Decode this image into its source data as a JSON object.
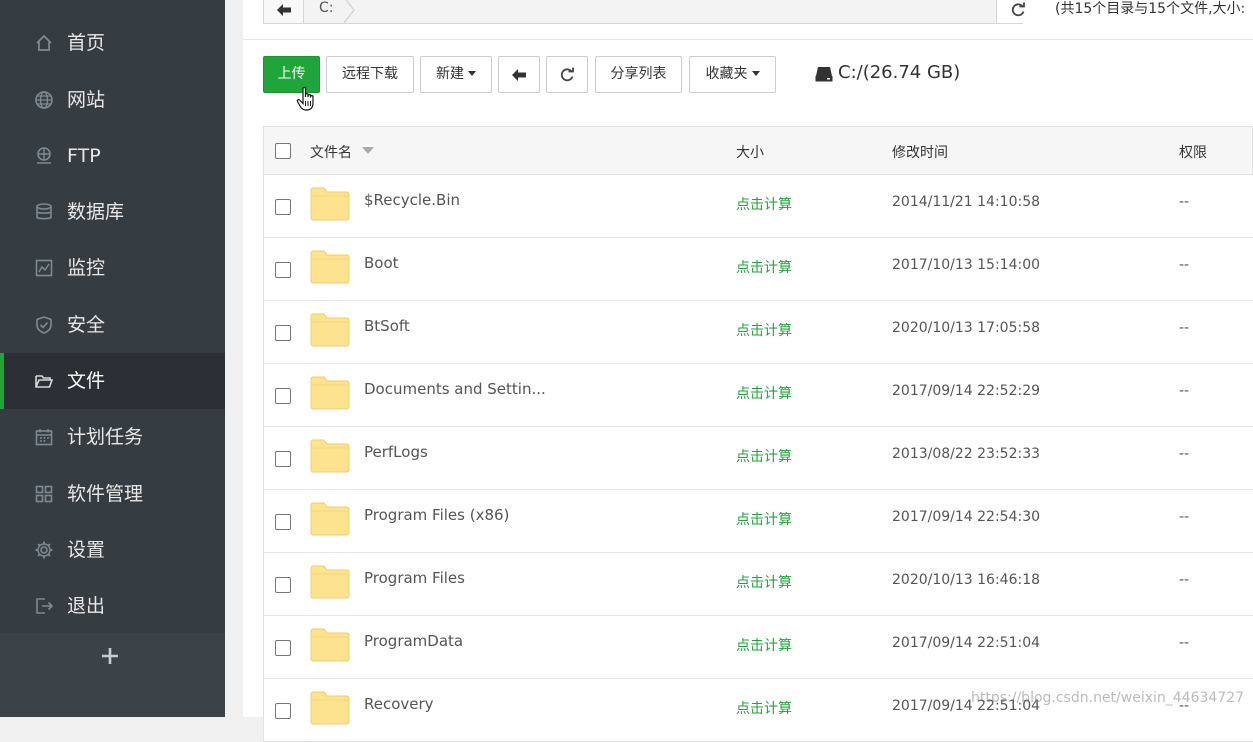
{
  "sidebar": {
    "items": [
      {
        "label": "首页",
        "icon": "home-icon"
      },
      {
        "label": "网站",
        "icon": "globe-icon"
      },
      {
        "label": "FTP",
        "icon": "ftp-icon"
      },
      {
        "label": "数据库",
        "icon": "database-icon"
      },
      {
        "label": "监控",
        "icon": "monitor-icon"
      },
      {
        "label": "安全",
        "icon": "shield-icon"
      },
      {
        "label": "文件",
        "icon": "folder-icon",
        "active": true
      },
      {
        "label": "计划任务",
        "icon": "calendar-icon"
      },
      {
        "label": "软件管理",
        "icon": "apps-icon"
      },
      {
        "label": "设置",
        "icon": "gear-icon"
      },
      {
        "label": "退出",
        "icon": "logout-icon"
      }
    ],
    "add_icon": "plus-icon"
  },
  "pathbar": {
    "path": "C:",
    "stats": "(共15个目录与15个文件,大小:"
  },
  "toolbar": {
    "upload": "上传",
    "remote_download": "远程下载",
    "new": "新建",
    "share_list": "分享列表",
    "favorites": "收藏夹",
    "disk_label": "C:/(26.74 GB)"
  },
  "table": {
    "headers": {
      "name": "文件名",
      "size": "大小",
      "mtime": "修改时间",
      "perm": "权限"
    },
    "rows": [
      {
        "name": "$Recycle.Bin",
        "size": "点击计算",
        "mtime": "2014/11/21 14:10:58",
        "perm": "--"
      },
      {
        "name": "Boot",
        "size": "点击计算",
        "mtime": "2017/10/13 15:14:00",
        "perm": "--"
      },
      {
        "name": "BtSoft",
        "size": "点击计算",
        "mtime": "2020/10/13 17:05:58",
        "perm": "--"
      },
      {
        "name": "Documents and Settin...",
        "size": "点击计算",
        "mtime": "2017/09/14 22:52:29",
        "perm": "--"
      },
      {
        "name": "PerfLogs",
        "size": "点击计算",
        "mtime": "2013/08/22 23:52:33",
        "perm": "--"
      },
      {
        "name": "Program Files (x86)",
        "size": "点击计算",
        "mtime": "2017/09/14 22:54:30",
        "perm": "--"
      },
      {
        "name": "Program Files",
        "size": "点击计算",
        "mtime": "2020/10/13 16:46:18",
        "perm": "--"
      },
      {
        "name": "ProgramData",
        "size": "点击计算",
        "mtime": "2017/09/14 22:51:04",
        "perm": "--"
      },
      {
        "name": "Recovery",
        "size": "点击计算",
        "mtime": "2017/09/14 22:51:04",
        "perm": "--"
      }
    ]
  },
  "watermark": "https://blog.csdn.net/weixin_44634727",
  "colors": {
    "accent": "#20a53a",
    "sidebar": "#353c42",
    "folder": "#fde28f"
  }
}
